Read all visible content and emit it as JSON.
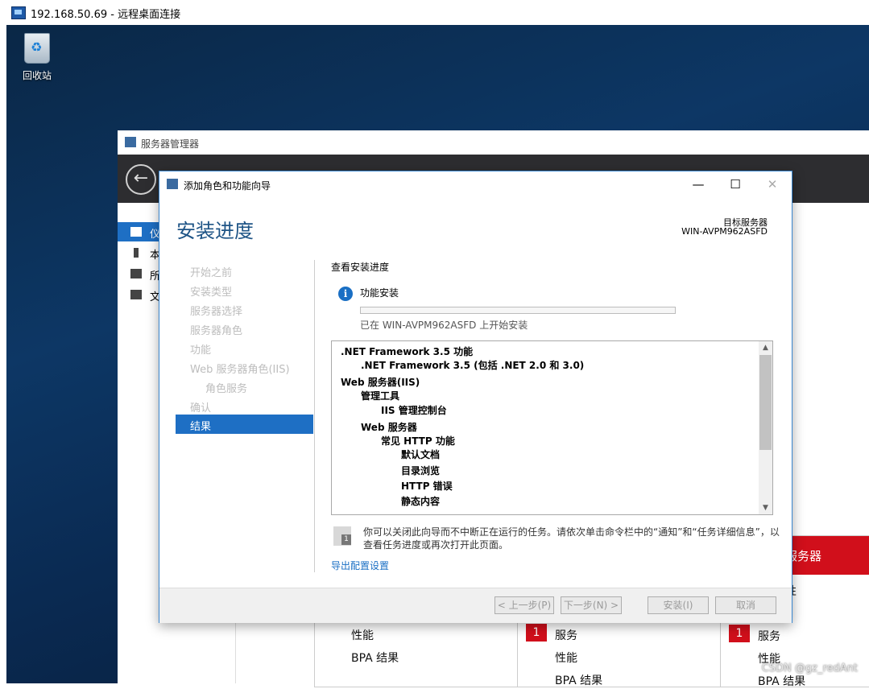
{
  "rdp": {
    "title": "192.168.50.69 - 远程桌面连接"
  },
  "desktop": {
    "recycle_bin": "回收站"
  },
  "server_manager": {
    "title": "服务器管理器",
    "nav": [
      {
        "label": "仪"
      },
      {
        "label": "本"
      },
      {
        "label": "所"
      },
      {
        "label": "文"
      }
    ],
    "tiles": {
      "col1": [
        "性能",
        "BPA 结果"
      ],
      "col2": {
        "badge": "1",
        "service": "服务",
        "perf": "性能",
        "bpa": "BPA 结果"
      },
      "col3": {
        "header": "服务器",
        "partial": "性",
        "badge": "1",
        "service": "服务",
        "perf": "性能",
        "bpa": "BPA 结果"
      }
    }
  },
  "wizard": {
    "title": "添加角色和功能向导",
    "heading": "安装进度",
    "target_label": "目标服务器",
    "target_name": "WIN-AVPM962ASFD",
    "steps": [
      "开始之前",
      "安装类型",
      "服务器选择",
      "服务器角色",
      "功能",
      "Web 服务器角色(IIS)",
      "角色服务",
      "确认"
    ],
    "selected_step": "结果",
    "progress_title": "查看安装进度",
    "feature_label": "功能安装",
    "progress_fraction": 0.0,
    "status_text": "已在 WIN-AVPM962ASFD 上开始安装",
    "items": [
      ".NET Framework 3.5 功能",
      ".NET Framework 3.5 (包括 .NET 2.0 和 3.0)",
      "Web 服务器(IIS)",
      "管理工具",
      "IIS 管理控制台",
      "Web 服务器",
      "常见 HTTP 功能",
      "默认文档",
      "目录浏览",
      "HTTP 错误",
      "静态内容"
    ],
    "note": "你可以关闭此向导而不中断正在运行的任务。请依次单击命令栏中的“通知”和“任务详细信息”，以查看任务进度或再次打开此页面。",
    "note_icon_number": "1",
    "export_link": "导出配置设置",
    "buttons": {
      "prev": "< 上一步(P)",
      "next": "下一步(N) >",
      "install": "安装(I)",
      "cancel": "取消"
    }
  },
  "watermark": "CSDN @gz_redAnt"
}
